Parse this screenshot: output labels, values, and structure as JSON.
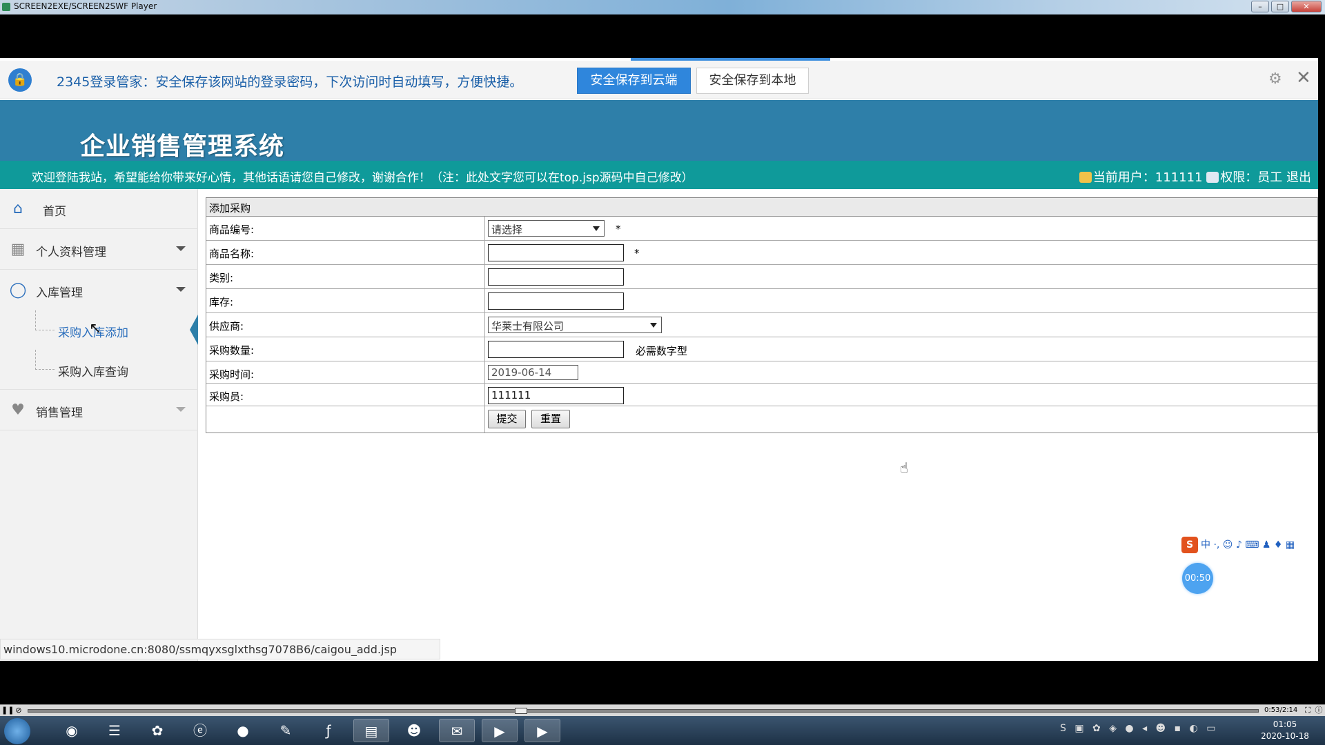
{
  "window": {
    "title": "SCREEN2EXE/SCREEN2SWF Player"
  },
  "password_bar": {
    "message": "2345登录管家：安全保存该网站的登录密码，下次访问时自动填写，方便快捷。",
    "save_cloud": "安全保存到云端",
    "save_local": "安全保存到本地"
  },
  "header": {
    "title": "企业销售管理系统",
    "welcome": "欢迎登陆我站，希望能给你带来好心情，其他话语请您自己修改，谢谢合作！（注：此处文字您可以在top.jsp源码中自己修改）",
    "current_user": "当前用户：111111",
    "role": "权限：员工",
    "logout": "退出"
  },
  "sidebar": {
    "home": "首页",
    "profile": "个人资料管理",
    "inbound": "入库管理",
    "sub_add": "采购入库添加",
    "sub_query": "采购入库查询",
    "sales": "销售管理"
  },
  "form": {
    "caption": "添加采购",
    "rows": [
      {
        "label": "商品编号:",
        "value": "请选择"
      },
      {
        "label": "商品名称:",
        "value": ""
      },
      {
        "label": "类别:",
        "value": ""
      },
      {
        "label": "库存:",
        "value": ""
      },
      {
        "label": "供应商:",
        "value": "华莱士有限公司"
      },
      {
        "label": "采购数量:",
        "value": ""
      },
      {
        "label": "采购时间:",
        "value": "2019-06-14"
      },
      {
        "label": "采购员:",
        "value": "111111"
      }
    ],
    "required_mark": "*",
    "qty_hint": "必需数字型",
    "submit": "提交",
    "reset": "重置"
  },
  "status_url": "windows10.microdone.cn:8080/ssmqyxsglxthsg7078B6/caigou_add.jsp",
  "ime": {
    "label": "中"
  },
  "timer": "00:50",
  "player": {
    "time": "0:53/2:14"
  },
  "clock": {
    "time": "01:05",
    "date": "2020-10-18"
  }
}
